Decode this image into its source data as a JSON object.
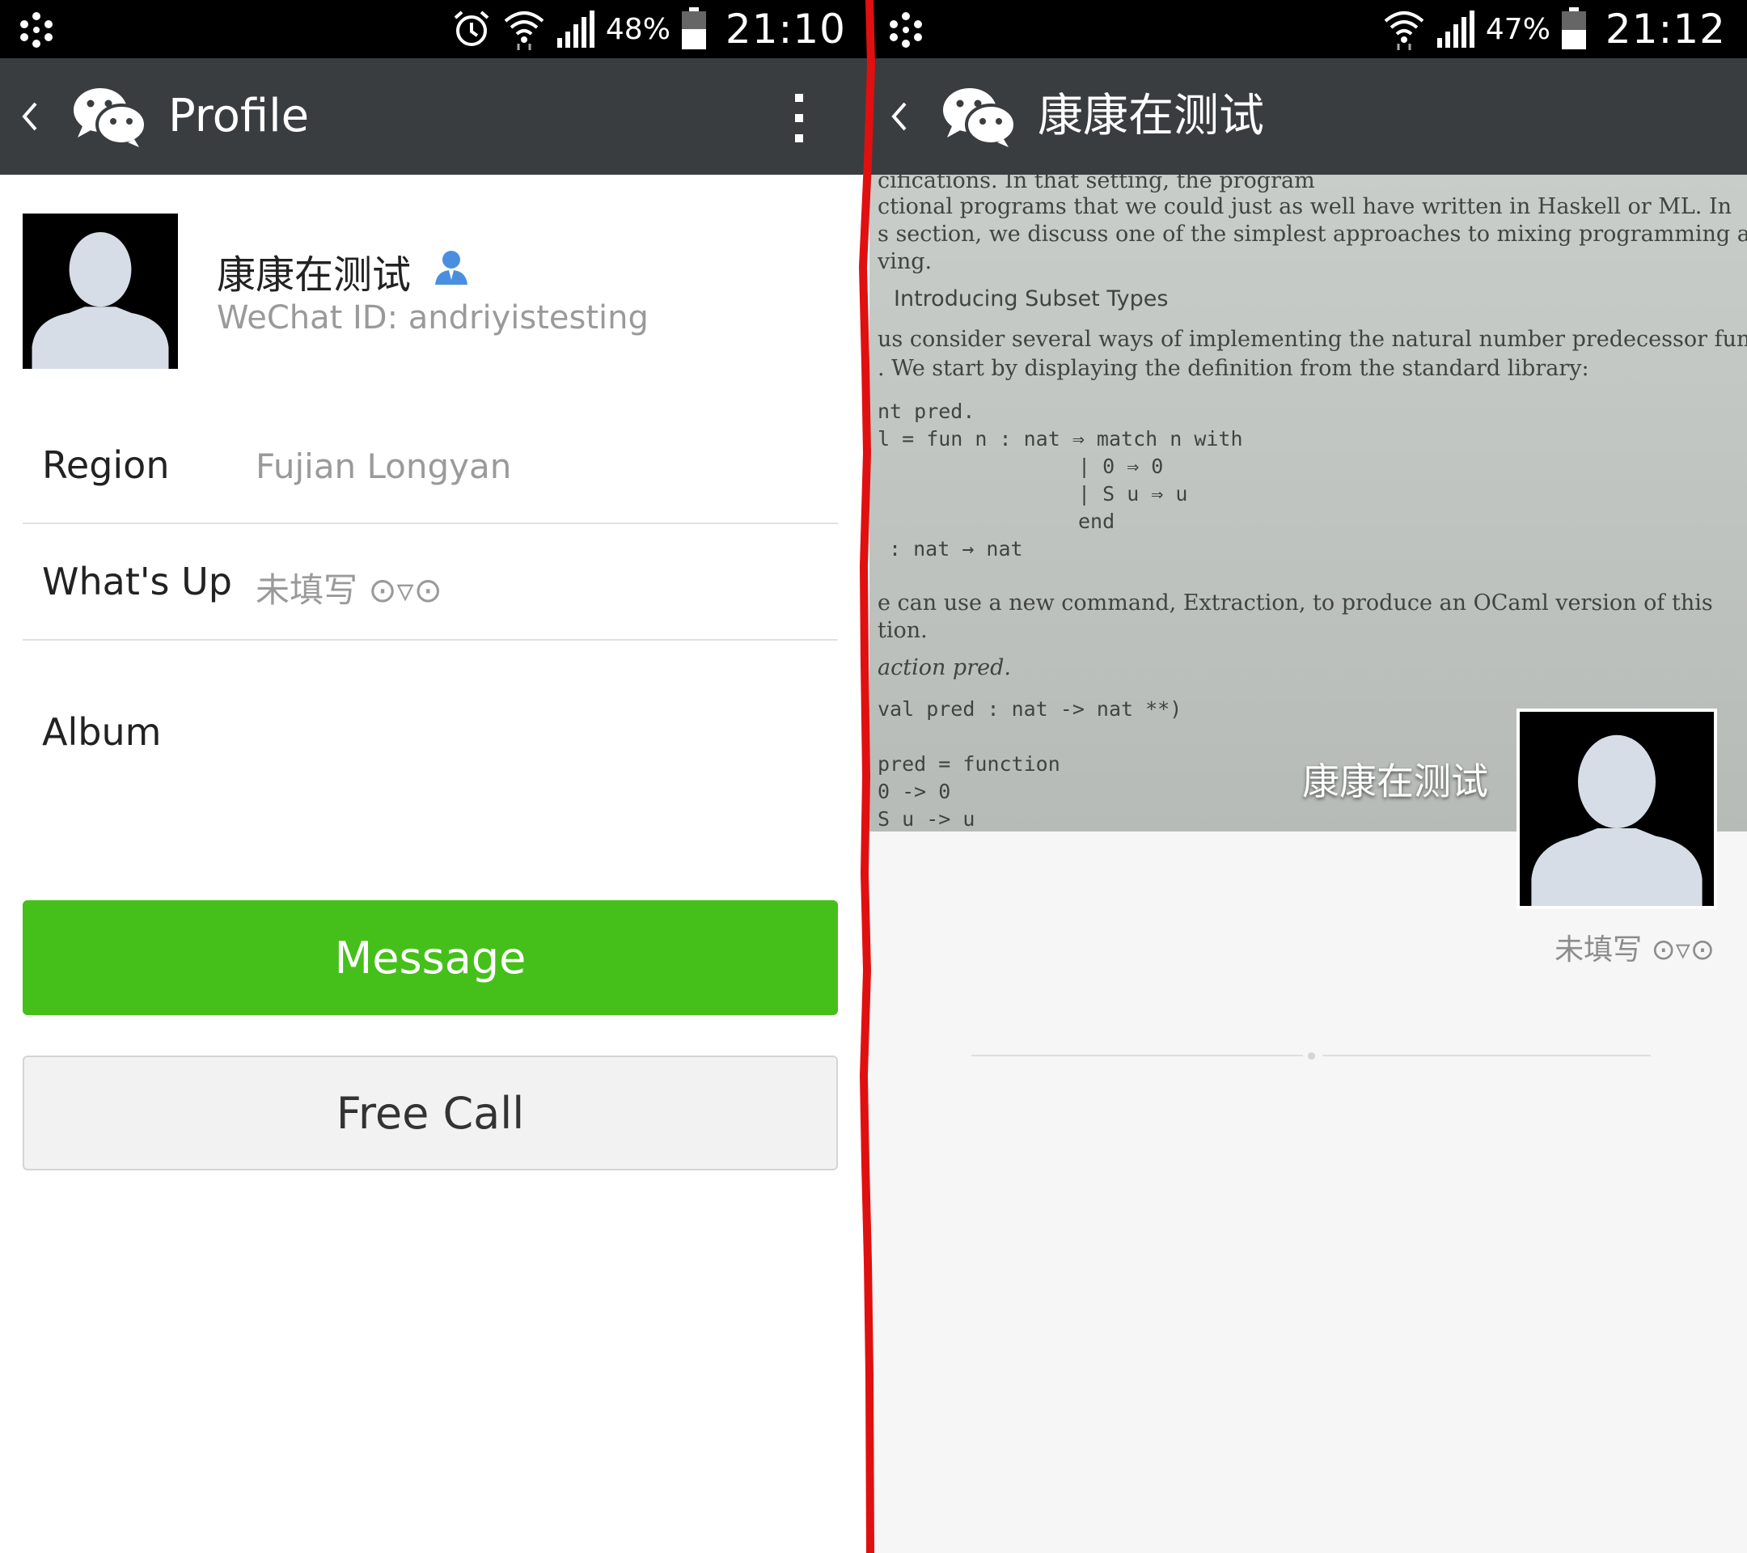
{
  "left": {
    "status_bar": {
      "battery_pct": "48%",
      "time": "21:10"
    },
    "header": {
      "title": "Profile"
    },
    "profile": {
      "name": "康康在测试",
      "wechat_id": "WeChat ID: andriyistesting"
    },
    "rows": [
      {
        "label": "Region",
        "value": "Fujian  Longyan"
      },
      {
        "label": "What's Up",
        "value": "未填写 ⊙▿⊙"
      },
      {
        "label": "Album",
        "value": ""
      }
    ],
    "buttons": {
      "message": "Message",
      "free_call": "Free Call"
    }
  },
  "right": {
    "status_bar": {
      "battery_pct": "47%",
      "time": "21:12"
    },
    "header": {
      "title": "康康在测试"
    },
    "cover": {
      "photo_text": [
        "cifications.  In that setting, the program",
        "ctional programs that we could just as well have written in Haskell or ML.  In",
        "s section, we discuss one of the simplest approaches to mixing programming and",
        "ving.",
        "Introducing Subset Types",
        " us consider several ways of implementing the natural number predecessor func-",
        ".  We start by displaying the definition from the standard library:",
        "nt pred.",
        "l = fun n : nat ⇒ match n with",
        "| 0 ⇒ 0",
        "| S u ⇒ u",
        "end",
        ": nat → nat",
        "e can use a new command, Extraction, to produce an OCaml version of this",
        "tion.",
        "action pred.",
        "val pred : nat -> nat **)",
        "pred = function",
        "0 -> 0",
        "S u -> u"
      ],
      "name": "康康在测试"
    },
    "status_text": "未填写 ⊙▿⊙"
  },
  "colors": {
    "header_bg": "#3a3d3f",
    "message_green": "#45c01a",
    "separator_red": "#e01010"
  }
}
